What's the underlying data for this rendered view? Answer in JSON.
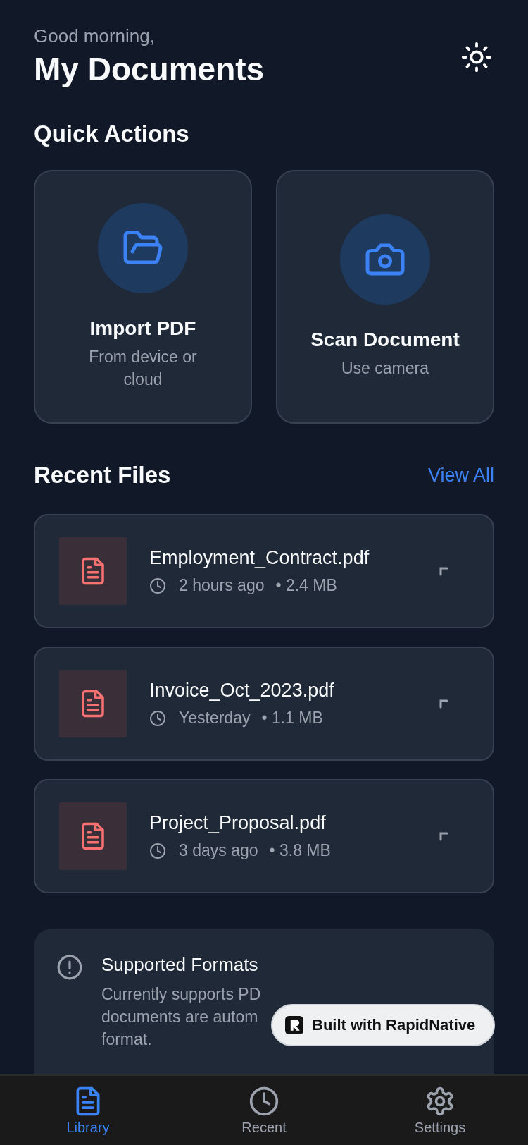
{
  "header": {
    "greeting": "Good morning,",
    "title": "My Documents"
  },
  "quick_actions": {
    "title": "Quick Actions",
    "items": [
      {
        "kind": "folder",
        "title": "Import PDF",
        "subtitle": "From device or cloud"
      },
      {
        "kind": "camera",
        "title": "Scan Document",
        "subtitle": "Use camera"
      }
    ]
  },
  "recent_files": {
    "title": "Recent Files",
    "view_all": "View All",
    "files": [
      {
        "name": "Employment_Contract.pdf",
        "time": "2 hours ago",
        "size": "• 2.4 MB"
      },
      {
        "name": "Invoice_Oct_2023.pdf",
        "time": "Yesterday",
        "size": "• 1.1 MB"
      },
      {
        "name": "Project_Proposal.pdf",
        "time": "3 days ago",
        "size": "• 3.8 MB"
      }
    ]
  },
  "info": {
    "title": "Supported Formats",
    "lines": [
      "Currently supports PD",
      "documents are autom",
      "format."
    ]
  },
  "badge": "Built with RapidNative",
  "tabs": [
    {
      "kind": "document",
      "label": "Library",
      "selected": true
    },
    {
      "kind": "clock",
      "label": "Recent",
      "selected": false
    },
    {
      "kind": "gear",
      "label": "Settings",
      "selected": false
    }
  ]
}
